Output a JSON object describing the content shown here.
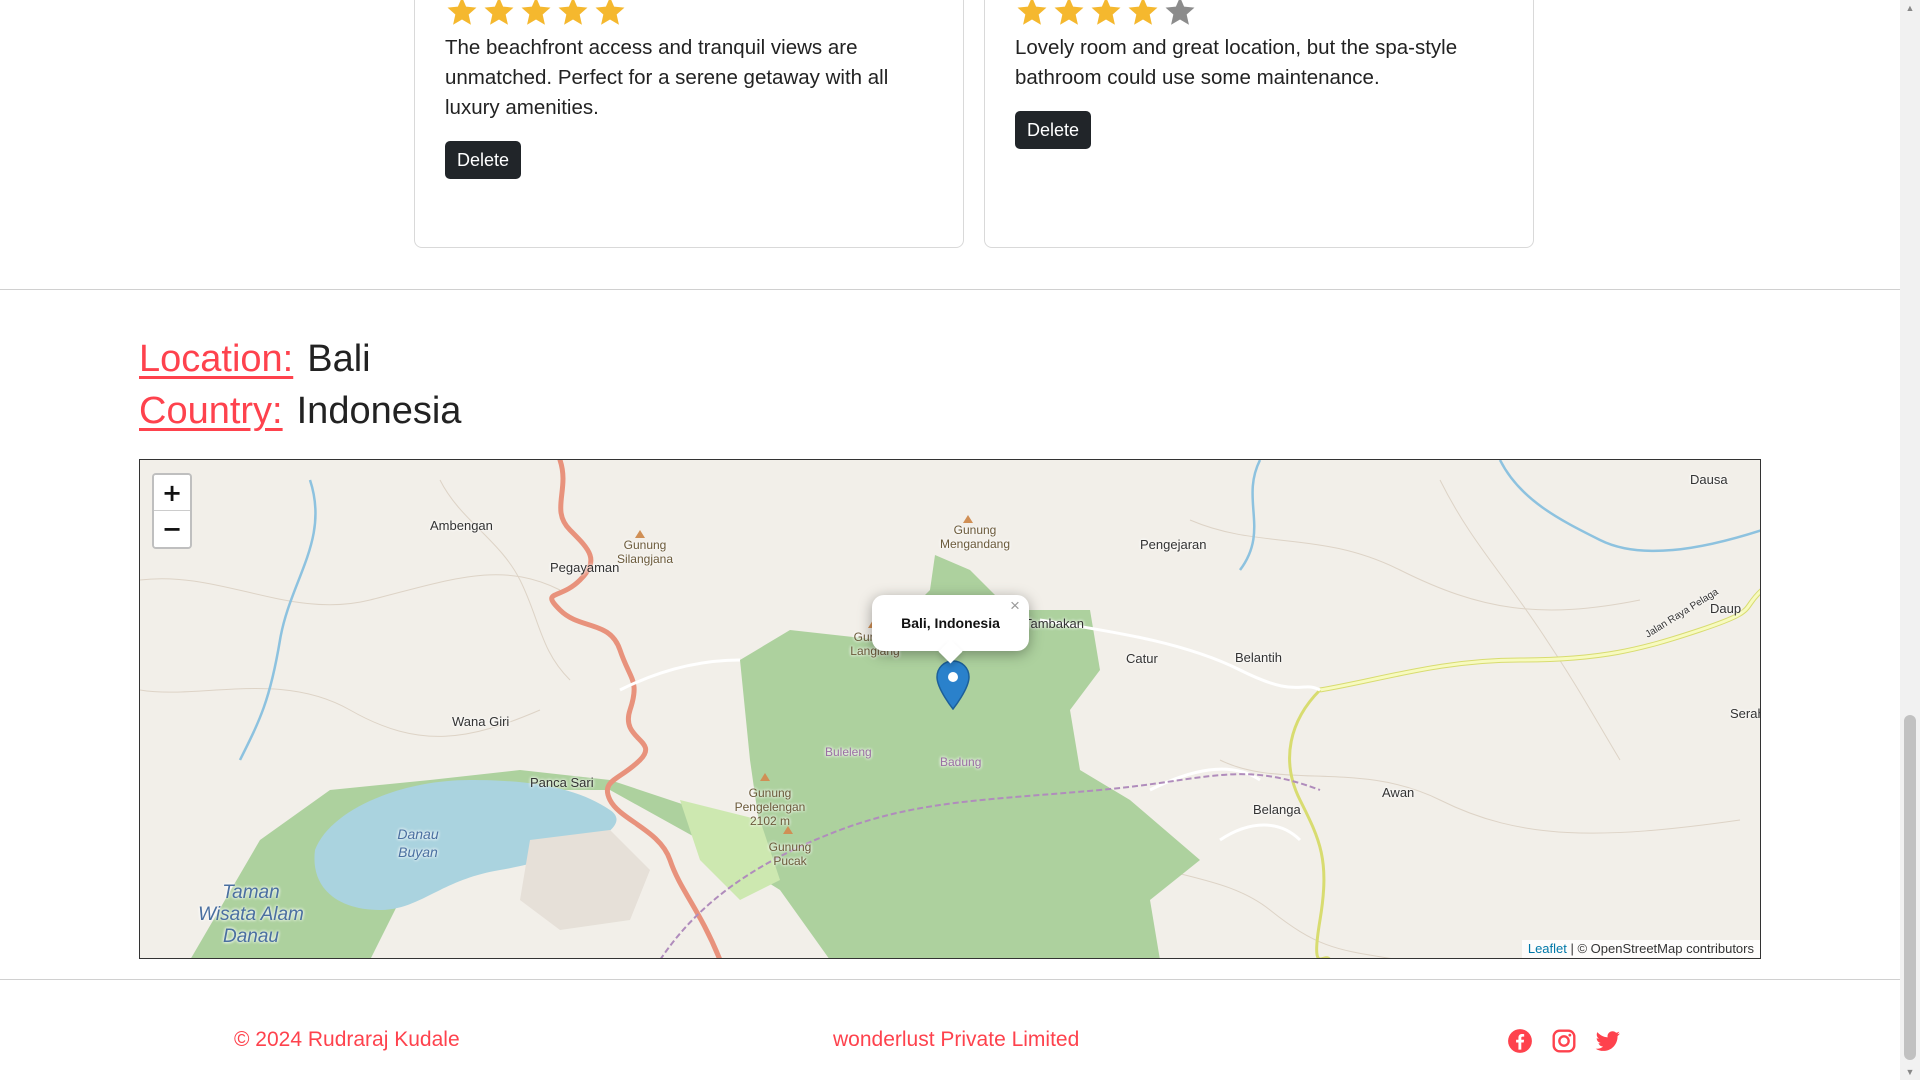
{
  "reviews": [
    {
      "rating": 5,
      "max_rating": 5,
      "comment": "The beachfront access and tranquil views are unmatched. Perfect for a serene getaway with all luxury amenities.",
      "delete_label": "Delete"
    },
    {
      "rating": 4,
      "max_rating": 5,
      "comment": "Lovely room and great location, but the spa-style bathroom could use some maintenance.",
      "delete_label": "Delete"
    }
  ],
  "listing": {
    "location_label": "Location:",
    "location_value": "Bali",
    "country_label": "Country:",
    "country_value": "Indonesia"
  },
  "map": {
    "zoom_in": "+",
    "zoom_out": "−",
    "popup_text": "Bali, Indonesia",
    "popup_close": "×",
    "attribution_link": "Leaflet",
    "attribution_text": " | © OpenStreetMap contributors",
    "labels": {
      "ambengan": "Ambengan",
      "pegayaman": "Pegayaman",
      "gunung_silangjana": "Gunung Silangjana",
      "gunung_mengandang": "Gunung Mengandang",
      "pengejaran": "Pengejaran",
      "dausa": "Dausa",
      "tambakan": "Tambakan",
      "catur": "Catur",
      "belantih": "Belantih",
      "daup": "Daup",
      "gunung_langlang": "Gunung Langlang",
      "wana_giri": "Wana Giri",
      "danau_buyan": "Danau Buyan",
      "panca_sari": "Panca Sari",
      "taman_wisata": "Taman Wisata Alam Danau",
      "gunung_pengelengan": "Gunung Pengelengan 2102 m",
      "gunung_pucak": "Gunung Pucak",
      "buleleng": "Buleleng",
      "badung": "Badung",
      "belanga": "Belanga",
      "awan": "Awan",
      "serah": "Serah",
      "jalan_raya": "Jalan Raya Pelaga"
    },
    "colors": {
      "forest": "#add19e",
      "water": "#aad3df",
      "land": "#f2efe9",
      "major_road": "#e8927c",
      "yellow_road": "#f7fabf",
      "marker": "#2a81cb"
    }
  },
  "footer": {
    "copyright": "© 2024 Rudraraj Kudale",
    "company": "wonderlust Private Limited",
    "social_icons": [
      "facebook-icon",
      "instagram-icon",
      "twitter-icon"
    ]
  },
  "colors": {
    "accent": "#fe424d",
    "star_filled": "#f5b82e",
    "star_empty": "#8c8c8c",
    "button_dark": "#212529"
  }
}
